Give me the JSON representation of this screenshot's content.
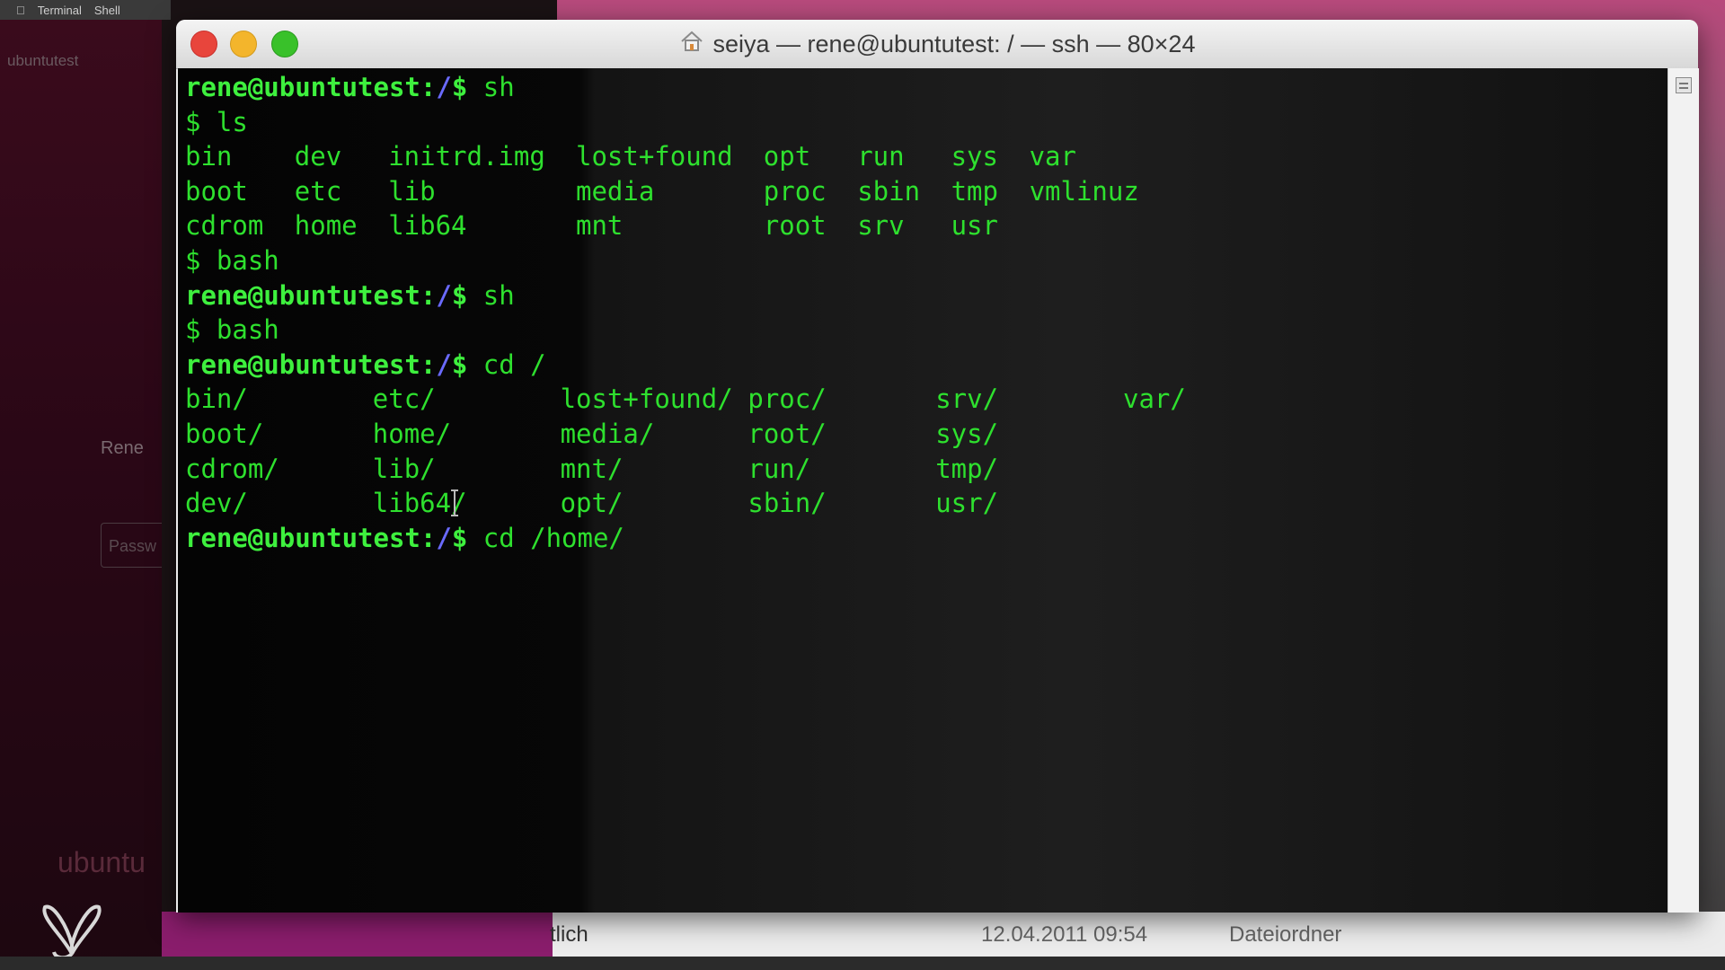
{
  "menubar": {
    "items": [
      "Terminal",
      "Shell"
    ]
  },
  "vm_login": {
    "host": "ubuntutest",
    "user": "Rene",
    "password_placeholder": "Passw",
    "brand": "ubuntu"
  },
  "window": {
    "title": "seiya — rene@ubuntutest: / — ssh — 80×24"
  },
  "terminal": {
    "lines": [
      {
        "type": "prompt",
        "user": "rene@ubuntutest:",
        "path": "/",
        "dollar": "$",
        "command": " sh"
      },
      {
        "type": "text",
        "cols": [
          {
            "t": "$ ls",
            "c": 0
          }
        ]
      },
      {
        "type": "text",
        "cols": [
          {
            "t": "bin",
            "c": 0
          },
          {
            "t": "dev",
            "c": 7
          },
          {
            "t": "initrd.img",
            "c": 13
          },
          {
            "t": "lost+found",
            "c": 25
          },
          {
            "t": "opt",
            "c": 37
          },
          {
            "t": "run",
            "c": 43
          },
          {
            "t": "sys",
            "c": 49
          },
          {
            "t": "var",
            "c": 54
          }
        ]
      },
      {
        "type": "text",
        "cols": [
          {
            "t": "boot",
            "c": 0
          },
          {
            "t": "etc",
            "c": 7
          },
          {
            "t": "lib",
            "c": 13
          },
          {
            "t": "media",
            "c": 25
          },
          {
            "t": "proc",
            "c": 37
          },
          {
            "t": "sbin",
            "c": 43
          },
          {
            "t": "tmp",
            "c": 49
          },
          {
            "t": "vmlinuz",
            "c": 54
          }
        ]
      },
      {
        "type": "text",
        "cols": [
          {
            "t": "cdrom",
            "c": 0
          },
          {
            "t": "home",
            "c": 7
          },
          {
            "t": "lib64",
            "c": 13
          },
          {
            "t": "mnt",
            "c": 25
          },
          {
            "t": "root",
            "c": 37
          },
          {
            "t": "srv",
            "c": 43
          },
          {
            "t": "usr",
            "c": 49
          }
        ]
      },
      {
        "type": "text",
        "cols": [
          {
            "t": "$ bash",
            "c": 0
          }
        ]
      },
      {
        "type": "prompt",
        "user": "rene@ubuntutest:",
        "path": "/",
        "dollar": "$",
        "command": " sh"
      },
      {
        "type": "text",
        "cols": [
          {
            "t": "$ bash",
            "c": 0
          }
        ]
      },
      {
        "type": "prompt",
        "user": "rene@ubuntutest:",
        "path": "/",
        "dollar": "$",
        "command": " cd /"
      },
      {
        "type": "text",
        "cols": [
          {
            "t": "bin/",
            "c": 0
          },
          {
            "t": "etc/",
            "c": 12
          },
          {
            "t": "lost+found/",
            "c": 24
          },
          {
            "t": "proc/",
            "c": 36
          },
          {
            "t": "srv/",
            "c": 48
          },
          {
            "t": "var/",
            "c": 60
          }
        ]
      },
      {
        "type": "text",
        "cols": [
          {
            "t": "boot/",
            "c": 0
          },
          {
            "t": "home/",
            "c": 12
          },
          {
            "t": "media/",
            "c": 24
          },
          {
            "t": "root/",
            "c": 36
          },
          {
            "t": "sys/",
            "c": 48
          }
        ]
      },
      {
        "type": "text",
        "cols": [
          {
            "t": "cdrom/",
            "c": 0
          },
          {
            "t": "lib/",
            "c": 12
          },
          {
            "t": "mnt/",
            "c": 24
          },
          {
            "t": "run/",
            "c": 36
          },
          {
            "t": "tmp/",
            "c": 48
          }
        ]
      },
      {
        "type": "text",
        "cols": [
          {
            "t": "dev/",
            "c": 0
          },
          {
            "t": "lib64/",
            "c": 12
          },
          {
            "t": "opt/",
            "c": 24
          },
          {
            "t": "sbin/",
            "c": 36
          },
          {
            "t": "usr/",
            "c": 48
          }
        ]
      },
      {
        "type": "prompt",
        "user": "rene@ubuntutest:",
        "path": "/",
        "dollar": "$",
        "command": " cd /home/"
      }
    ]
  },
  "finder_row": {
    "name_fragment": "tlich",
    "date": "12.04.2011 09:54",
    "kind": "Dateiordner"
  },
  "colors": {
    "prompt_green": "#3ef03e",
    "output_green": "#2ee02e",
    "path_blue": "#6a6aff",
    "close": "#e8453c",
    "minimize": "#f3b52c",
    "maximize": "#39c12a"
  }
}
